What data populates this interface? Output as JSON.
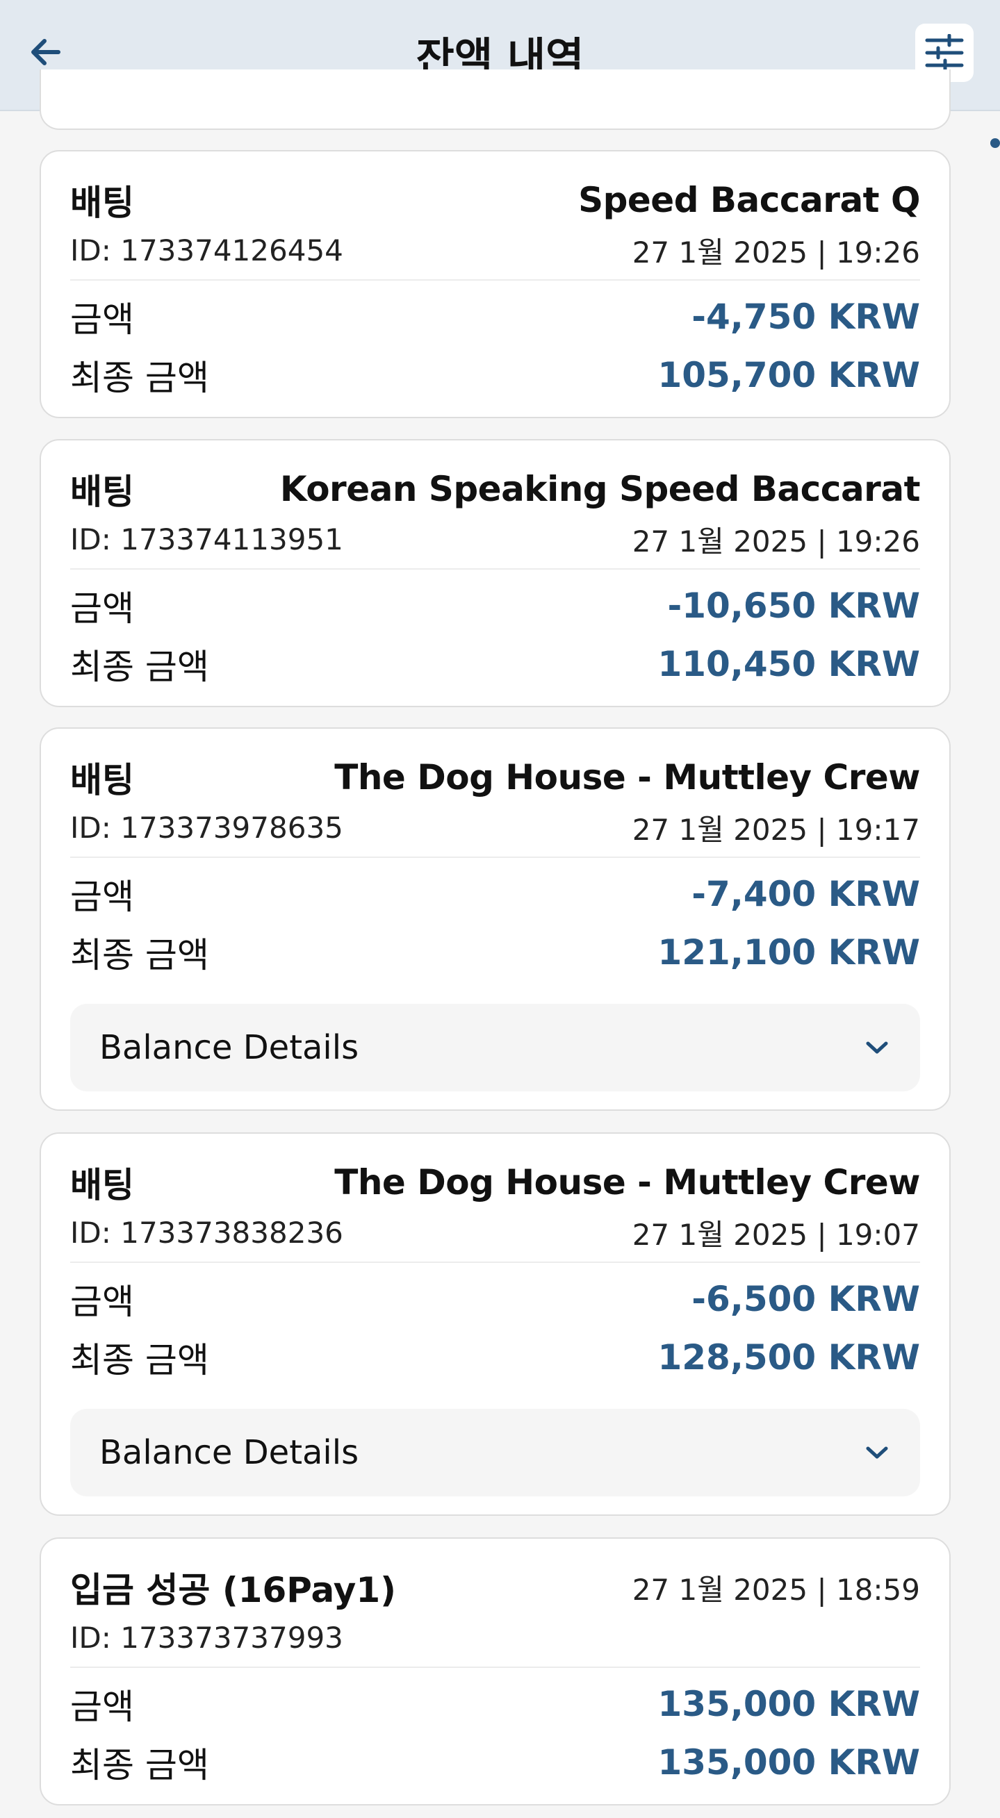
{
  "header": {
    "title": "잔액 내역"
  },
  "labels": {
    "amount": "금액",
    "final_amount": "최종 금액",
    "balance_details": "Balance Details"
  },
  "transactions": [
    {
      "type": "배팅",
      "game": "Speed Baccarat Q",
      "id": "ID: 173374126454",
      "date": "27 1월 2025 | 19:26",
      "amount": "-4,750 KRW",
      "final": "105,700 KRW"
    },
    {
      "type": "배팅",
      "game": "Korean Speaking Speed Baccarat",
      "id": "ID: 173374113951",
      "date": "27 1월 2025 | 19:26",
      "amount": "-10,650 KRW",
      "final": "110,450 KRW"
    },
    {
      "type": "배팅",
      "game": "The Dog House - Muttley Crew",
      "id": "ID: 173373978635",
      "date": "27 1월 2025 | 19:17",
      "amount": "-7,400 KRW",
      "final": "121,100 KRW"
    },
    {
      "type": "배팅",
      "game": "The Dog House - Muttley Crew",
      "id": "ID: 173373838236",
      "date": "27 1월 2025 | 19:07",
      "amount": "-6,500 KRW",
      "final": "128,500 KRW"
    },
    {
      "type": "입금 성공 (16Pay1)",
      "game": "",
      "id": "ID: 173373737993",
      "date": "27 1월 2025 | 18:59",
      "amount": "135,000 KRW",
      "final": "135,000 KRW"
    }
  ],
  "colors": {
    "header_bg": "#e2e9f0",
    "page_bg": "#f5f5f5",
    "amount": "#2a5a86",
    "card_border": "#dddddd"
  },
  "icons": {
    "back": "arrow-left-icon",
    "filter": "sliders-icon",
    "expand": "chevron-down-icon"
  }
}
